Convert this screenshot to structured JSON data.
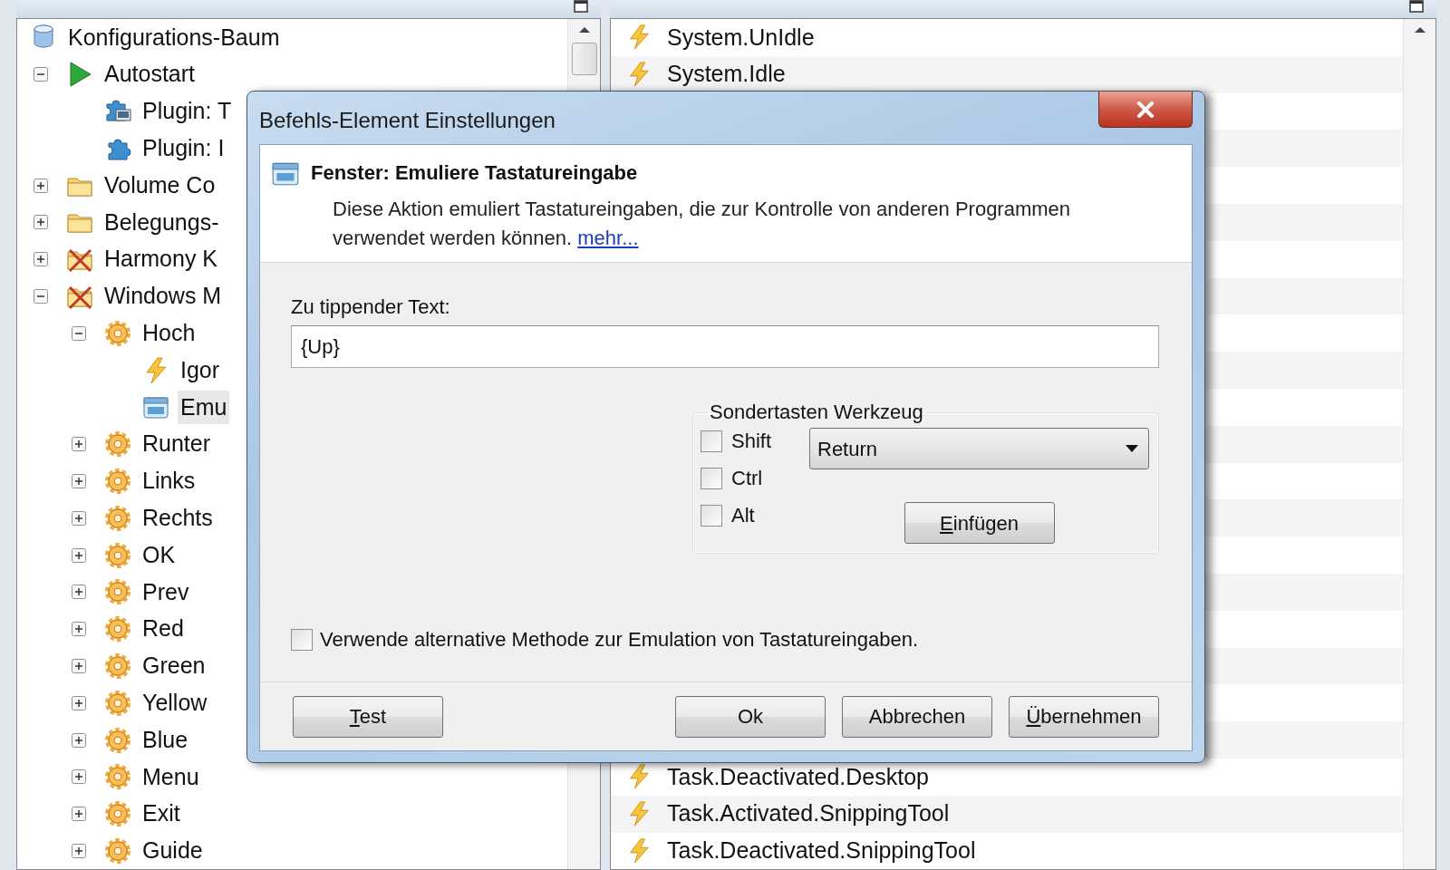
{
  "configuration_tree": {
    "items": [
      {
        "label": "Konfigurations-Baum",
        "kind": "database",
        "selected": false,
        "children": [
          {
            "label": "Autostart",
            "kind": "play",
            "expanded": true,
            "selected": false,
            "children": [
              {
                "label": "Plugin: T",
                "kind": "plugin-monitor",
                "selected": false
              },
              {
                "label": "Plugin: I",
                "kind": "plugin",
                "selected": false
              }
            ]
          },
          {
            "label": "Volume Co",
            "kind": "folder",
            "expanded": false,
            "selected": false
          },
          {
            "label": "Belegungs-",
            "kind": "folder",
            "expanded": false,
            "selected": false
          },
          {
            "label": "Harmony K",
            "kind": "folder-disabled",
            "expanded": false,
            "selected": false
          },
          {
            "label": "Windows M",
            "kind": "folder-disabled",
            "expanded": true,
            "selected": false,
            "children": [
              {
                "label": "Hoch",
                "kind": "gear",
                "expanded": true,
                "selected": false,
                "children": [
                  {
                    "label": "Igor",
                    "kind": "event",
                    "selected": false
                  },
                  {
                    "label": "Emu",
                    "kind": "action",
                    "selected": true
                  }
                ]
              },
              {
                "label": "Runter",
                "kind": "gear",
                "expanded": false,
                "selected": false
              },
              {
                "label": "Links",
                "kind": "gear",
                "expanded": false,
                "selected": false
              },
              {
                "label": "Rechts",
                "kind": "gear",
                "expanded": false,
                "selected": false
              },
              {
                "label": "OK",
                "kind": "gear",
                "expanded": false,
                "selected": false
              },
              {
                "label": "Prev",
                "kind": "gear",
                "expanded": false,
                "selected": false
              },
              {
                "label": "Red",
                "kind": "gear",
                "expanded": false,
                "selected": false
              },
              {
                "label": "Green",
                "kind": "gear",
                "expanded": false,
                "selected": false
              },
              {
                "label": "Yellow",
                "kind": "gear",
                "expanded": false,
                "selected": false
              },
              {
                "label": "Blue",
                "kind": "gear",
                "expanded": false,
                "selected": false
              },
              {
                "label": "Menu",
                "kind": "gear",
                "expanded": false,
                "selected": false
              },
              {
                "label": "Exit",
                "kind": "gear",
                "expanded": false,
                "selected": false
              },
              {
                "label": "Guide",
                "kind": "gear",
                "expanded": false,
                "selected": false
              }
            ]
          }
        ]
      }
    ]
  },
  "log": {
    "rows_above_dialog": [
      "System.UnIdle",
      "System.Idle"
    ],
    "rows_below_dialog": [
      "Task.Deactivated.Desktop",
      "Task.Activated.SnippingTool",
      "Task.Deactivated.SnippingTool"
    ]
  },
  "dialog": {
    "title": "Befehls-Element Einstellungen",
    "header": {
      "title": "Fenster: Emuliere Tastatureingabe",
      "description": "Diese Aktion emuliert Tastatureingaben, die zur Kontrolle von anderen Programmen verwendet werden können.",
      "link": "mehr..."
    },
    "text_field": {
      "label": "Zu tippender Text:",
      "value": "{Up}"
    },
    "special_keys": {
      "title": "Sondertasten Werkzeug",
      "modifiers": [
        {
          "label": "Shift",
          "checked": false
        },
        {
          "label": "Ctrl",
          "checked": false
        },
        {
          "label": "Alt",
          "checked": false
        }
      ],
      "key": "Return",
      "insert_button": {
        "label": "Einfügen",
        "mnemonic_underlined": true
      }
    },
    "alternative_method": {
      "label": "Verwende alternative Methode zur Emulation von Tastatureingaben.",
      "checked": false
    },
    "buttons_left": [
      {
        "label": "Test",
        "mnemonic_underlined": true
      }
    ],
    "buttons_right": [
      {
        "label": "Ok",
        "mnemonic_underlined": false
      },
      {
        "label": "Abbrechen",
        "mnemonic_underlined": false
      },
      {
        "label": "Übernehmen",
        "mnemonic_underlined": true
      }
    ]
  }
}
